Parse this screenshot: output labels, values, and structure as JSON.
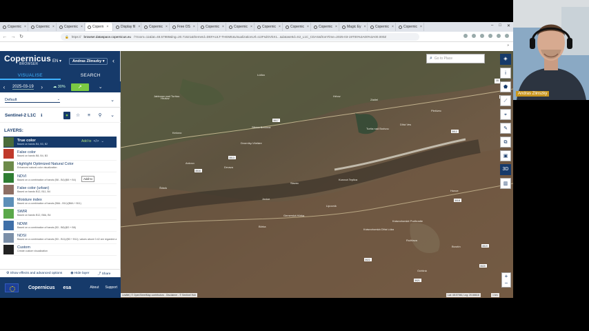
{
  "browser": {
    "tabs": [
      {
        "label": "Copernic"
      },
      {
        "label": "Copernic"
      },
      {
        "label": "Copernic"
      },
      {
        "label": "Copern"
      },
      {
        "label": "Display fil"
      },
      {
        "label": "Copernic"
      },
      {
        "label": "Free OS"
      },
      {
        "label": "Copernic"
      },
      {
        "label": "Copernic"
      },
      {
        "label": "Copernic"
      },
      {
        "label": "Copernic"
      },
      {
        "label": "Copernic"
      },
      {
        "label": "Magic Ey"
      },
      {
        "label": "Copernic"
      },
      {
        "label": "Copernic"
      }
    ],
    "url_prefix": "https://",
    "url_host": "browser.dataspace.copernicus.eu",
    "url_path": "/?zoom=11&lat=48.57989&lng=20.71621&themeId=DEFAULT-THEME&visualizationUrl=U2FsdGVkX1...&datasetId=S2_L1C_CDAS&fromTime=2025-03-19T00%3A00%3A00.000Z",
    "window_controls": [
      "–",
      "□",
      "✕"
    ],
    "bookmarks_label": "»"
  },
  "sidebar": {
    "logo": "Copernicus",
    "logo_sub": "BROWSER",
    "lang": "EN ▾",
    "user": "Andras Zlinszky ▾",
    "collapse": "‹",
    "tabs": {
      "visualise": "VISUALISE",
      "search": "SEARCH"
    },
    "date": "2025-03-19",
    "cloud": "☁ 30%",
    "go": "↗",
    "date_chevron": "⌄",
    "theme": "Default",
    "theme_dropdown": "⌄",
    "theme_chevron": "⌄",
    "dataset": "Sentinel-2 L1C",
    "dataset_info": "ℹ",
    "dataset_chevron": "⌄",
    "layers_header": "LAYERS:",
    "layers": [
      {
        "name": "True color",
        "desc": "Based on bands B4, B3, B2",
        "color": "#4a6b3a"
      },
      {
        "name": "False color",
        "desc": "Based on bands B8, B4, B3",
        "color": "#c0392b"
      },
      {
        "name": "Highlight Optimized Natural Color",
        "desc": "Enhanced natural color visualization",
        "color": "#6d8a4a"
      },
      {
        "name": "NDVI",
        "desc": "Based on a combination of bands (B8 - B4)/(B8 + B4)",
        "color": "#2e7d32"
      },
      {
        "name": "False color (urban)",
        "desc": "Based on bands B12, B11, B4",
        "color": "#8d6e63"
      },
      {
        "name": "Moisture index",
        "desc": "Based on a combination of bands (B8A - B11)/(B8A + B11)",
        "color": "#5d8fb8"
      },
      {
        "name": "SWIR",
        "desc": "Based on bands B12, B8A, B4",
        "color": "#5aa84a"
      },
      {
        "name": "NDWI",
        "desc": "Based on a combination of bands (B3 - B8)/(B3 + B8)",
        "color": "#3f6fa8"
      },
      {
        "name": "NDSI",
        "desc": "Based on a combination of bands (B3 - B11)/(B3 + B11); values above 0.42 are regarded as snowy",
        "color": "#7b8fa8"
      },
      {
        "name": "Custom",
        "desc": "Create custom visualization",
        "color": "#222222"
      }
    ],
    "add_to": "Add to",
    "tooltip": "Add to",
    "effects": "Show effects and advanced options",
    "hide_layer": "Hide layer",
    "share": "Share",
    "footer_logo": "Copernicus",
    "footer_esa": "esa",
    "about": "About",
    "support": "Support"
  },
  "map": {
    "search_placeholder": "Go to Place",
    "attribution": "Leaflet | © OpenStreetMap contributors - Disclaimer - © Sentinel Hub",
    "coords": "Lat: 48.57946, Lng: 20.66616",
    "scale": "1 km",
    "zoom_in": "+",
    "zoom_out": "−",
    "place_labels": [
      "Jablonov nad Turňou",
      "Hrušov",
      "Lúčka",
      "Silická Brezová",
      "Kečovo",
      "Dvorníky-Včeláre",
      "Zádiel",
      "Turňa nad Bodvou",
      "Hrhov",
      "Dlhá Ves",
      "Plešivec",
      "Ardovo",
      "Drnava",
      "Štítnik",
      "Slavec",
      "Kunová Teplica",
      "Jovice",
      "Gemerská Hôrka",
      "Lipovník",
      "Bôrka",
      "Krásnohorské Podhradie",
      "Krásnohorská Dlhá Lúka",
      "Rožňava",
      "Brzotín",
      "Honce",
      "Ochtiná"
    ],
    "road_labels": [
      "3017",
      "3013",
      "3016",
      "3012",
      "50",
      "3018",
      "3019",
      "3020",
      "3021",
      "3022"
    ]
  },
  "webcam": {
    "name": "Andras Zlinszky"
  },
  "colors": {
    "brand": "#163a6a",
    "accent": "#3fb3ff",
    "go": "#7ac943"
  }
}
